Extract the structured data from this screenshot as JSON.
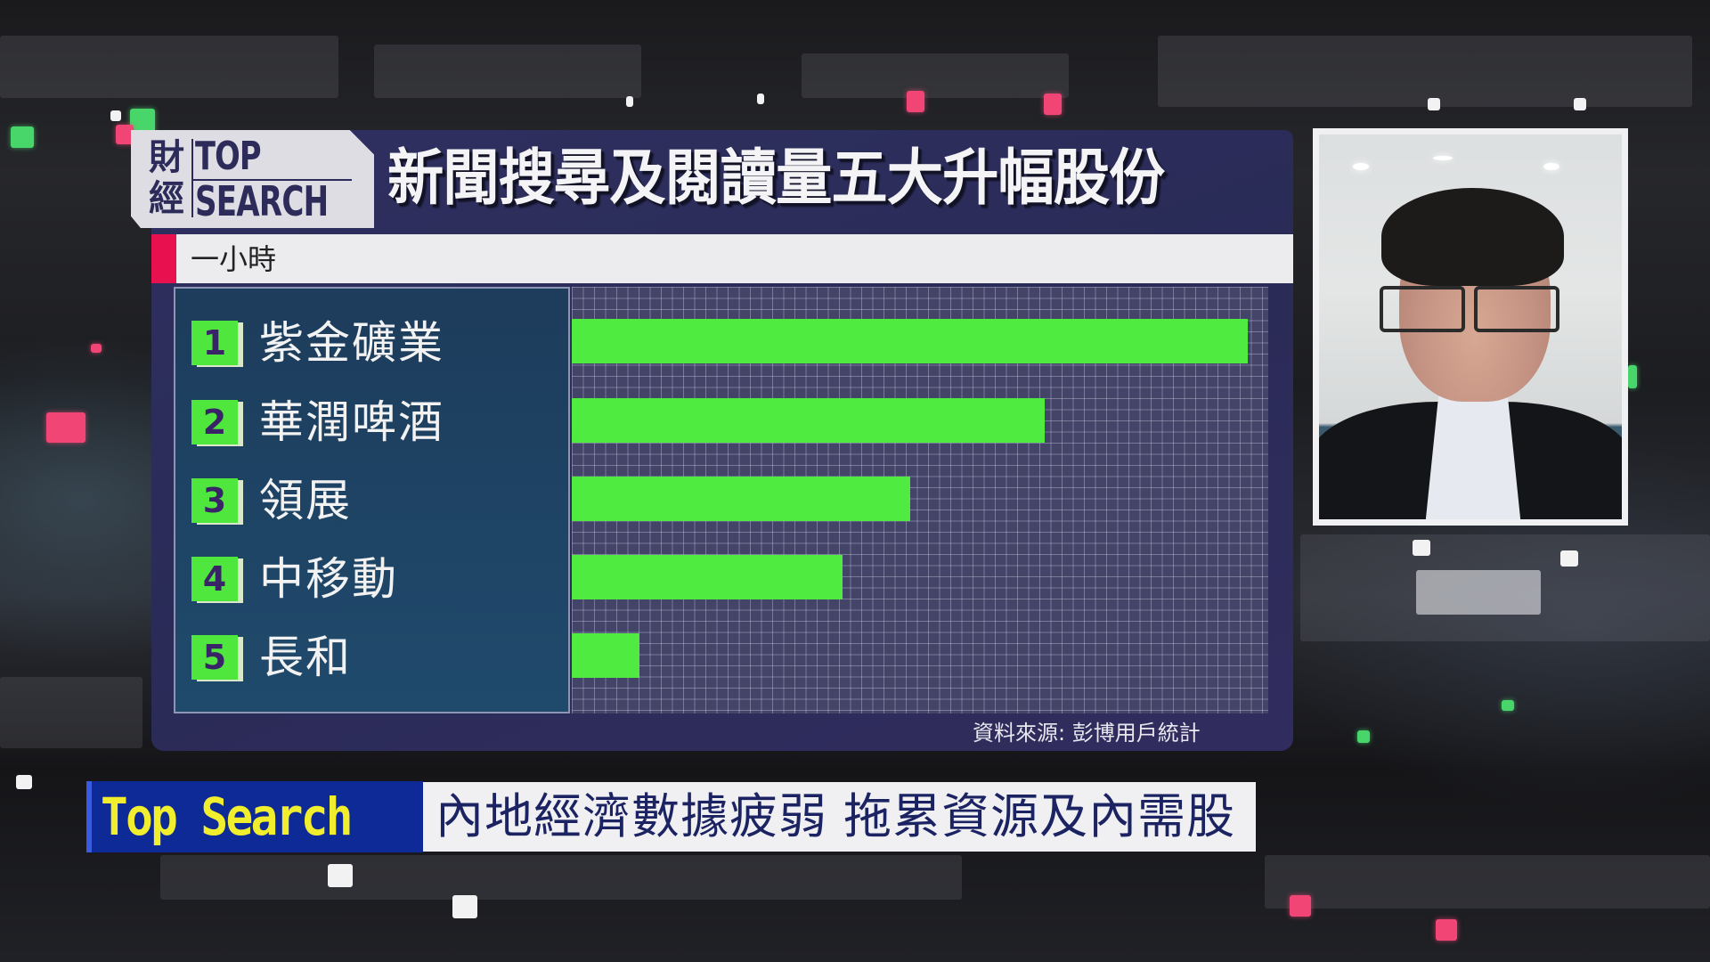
{
  "broadcast": {
    "logo": {
      "chinese_top": "財",
      "chinese_bottom": "經",
      "english_top": "TOP",
      "english_bottom": "SEARCH"
    },
    "title": "新聞搜尋及閱讀量五大升幅股份",
    "period_label": "一小時",
    "source": "資料來源: 彭博用戶統計",
    "ticker": {
      "tag": "Top Search",
      "headline": "內地經濟數據疲弱 拖累資源及內需股"
    },
    "colors": {
      "panel": "#2c2d5b",
      "bar": "#4feb41",
      "accent": "#e8104f",
      "ticker_tag_bg": "#0e2a96",
      "ticker_tag_text": "#f1ee2e"
    }
  },
  "chart_data": {
    "type": "bar",
    "orientation": "horizontal",
    "title": "新聞搜尋及閱讀量五大升幅股份",
    "subtitle": "一小時",
    "categories": [
      "紫金礦業",
      "華潤啤酒",
      "領展",
      "中移動",
      "長和"
    ],
    "ranks": [
      "1",
      "2",
      "3",
      "4",
      "5"
    ],
    "values": [
      100,
      70,
      50,
      40,
      10
    ],
    "value_unit": "relative (no axis labels shown; estimated as % of top bar)",
    "xlabel": "",
    "ylabel": "",
    "xlim": [
      0,
      103
    ],
    "grid": true,
    "source": "資料來源: 彭博用戶統計"
  }
}
